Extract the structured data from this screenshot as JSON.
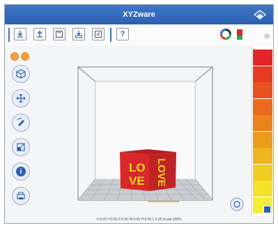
{
  "window": {
    "title": "XYZware"
  },
  "toolbar": {
    "buttons": [
      {
        "name": "import-button",
        "icon": "import-icon"
      },
      {
        "name": "export-button",
        "icon": "export-icon"
      },
      {
        "name": "save-button",
        "icon": "save-icon"
      },
      {
        "name": "print-button",
        "icon": "print-icon"
      },
      {
        "name": "edit-button",
        "icon": "edit-icon"
      },
      {
        "name": "help-button",
        "icon": "help-icon",
        "label": "?"
      }
    ],
    "right": [
      {
        "name": "model-color-button",
        "icon": "color-wheel-icon"
      },
      {
        "name": "filament-button",
        "icon": "filament-icon"
      }
    ]
  },
  "left_tools": [
    {
      "name": "view-tool",
      "icon": "cube-icon"
    },
    {
      "name": "move-tool",
      "icon": "move-arrows-icon"
    },
    {
      "name": "rotate-tool",
      "icon": "rotate-icon"
    },
    {
      "name": "scale-tool",
      "icon": "scale-icon"
    },
    {
      "name": "info-tool",
      "icon": "info-icon",
      "label": "i"
    },
    {
      "name": "print-settings-tool",
      "icon": "printer-icon"
    }
  ],
  "model": {
    "front_text": "LOVE",
    "side_text": "LOVE",
    "front_color": "#d8282a",
    "text_color": "#f1d21e"
  },
  "palette": {
    "colors": [
      "#e32626",
      "#e63a22",
      "#e8521f",
      "#ea6a1d",
      "#ec821c",
      "#ee9a1c",
      "#f0b41e",
      "#f2cc22",
      "#f4e22a",
      "#f4ee36"
    ]
  },
  "status": {
    "text": "X:0.00  Y:0.00  Z:0.00  W:0.00  H:0.00  L:0.00  Scale:100%"
  }
}
